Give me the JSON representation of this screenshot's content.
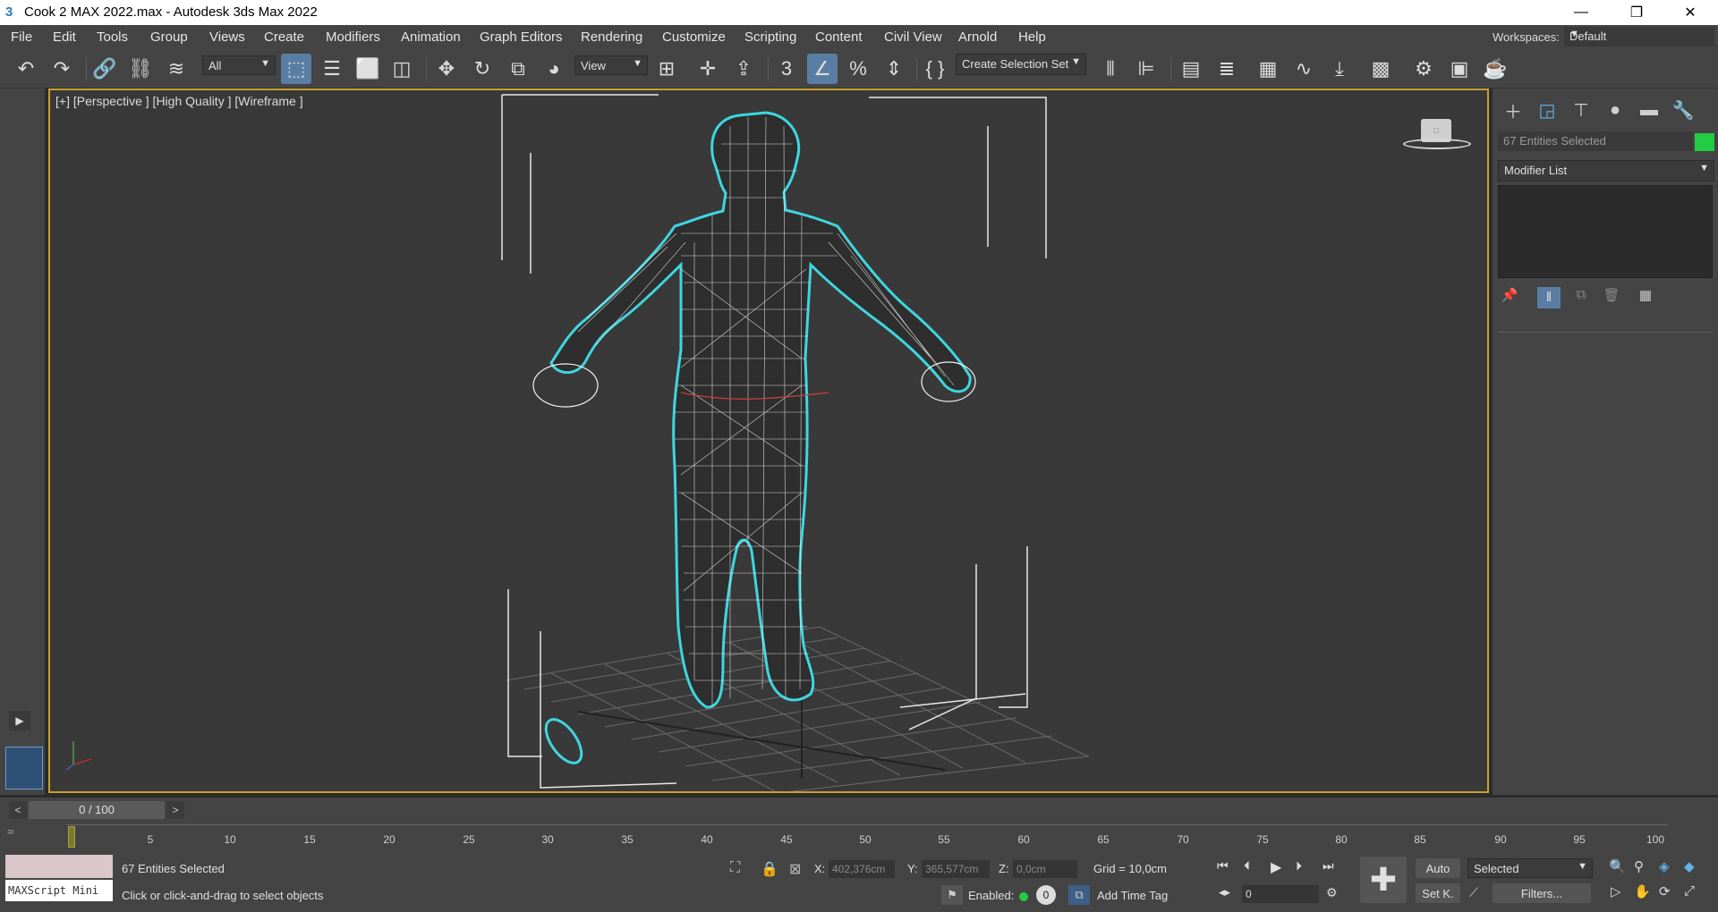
{
  "window": {
    "title": "Cook 2 MAX 2022.max - Autodesk 3ds Max 2022",
    "minimize": "—",
    "restore": "❐",
    "close": "✕"
  },
  "menu": [
    "File",
    "Edit",
    "Tools",
    "Group",
    "Views",
    "Create",
    "Modifiers",
    "Animation",
    "Graph Editors",
    "Rendering",
    "Customize",
    "Scripting",
    "Content",
    "Civil View",
    "Arnold",
    "Help"
  ],
  "workspaces": {
    "label": "Workspaces:",
    "value": "Default"
  },
  "toolbar": {
    "filter_value": "All",
    "ref_coord_value": "View",
    "selection_set_value": "Create Selection Set"
  },
  "viewport": {
    "label": "[+] [Perspective ] [High Quality ] [Wireframe ]"
  },
  "command_panel": {
    "selection_name": "67 Entities Selected",
    "selection_color": "#22cc44",
    "modifier_list": "Modifier List"
  },
  "timeline": {
    "slider_text": "0 / 100",
    "prev": "<",
    "next": ">",
    "ticks": [
      "5",
      "10",
      "15",
      "20",
      "25",
      "30",
      "35",
      "40",
      "45",
      "50",
      "55",
      "60",
      "65",
      "70",
      "75",
      "80",
      "85",
      "90",
      "95",
      "100"
    ]
  },
  "status": {
    "maxscript": "MAXScript Mini",
    "selected_count": "67 Entities Selected",
    "prompt": "Click or click-and-drag to select objects",
    "x_label": "X:",
    "x_value": "402,376cm",
    "y_label": "Y:",
    "y_value": "365,577cm",
    "z_label": "Z:",
    "z_value": "0,0cm",
    "grid": "Grid = 10,0cm",
    "enabled_label": "Enabled:",
    "enabled_value": "0",
    "add_time_tag": "Add Time Tag",
    "auto_key": "Auto",
    "set_key": "Set K.",
    "key_mode_value": "Selected",
    "frame_value": "0",
    "filters": "Filters..."
  },
  "colors": {
    "selection_outline": "#3fd6e0",
    "viewport_border": "#c8a032",
    "active_tool": "#5a7ea3"
  }
}
